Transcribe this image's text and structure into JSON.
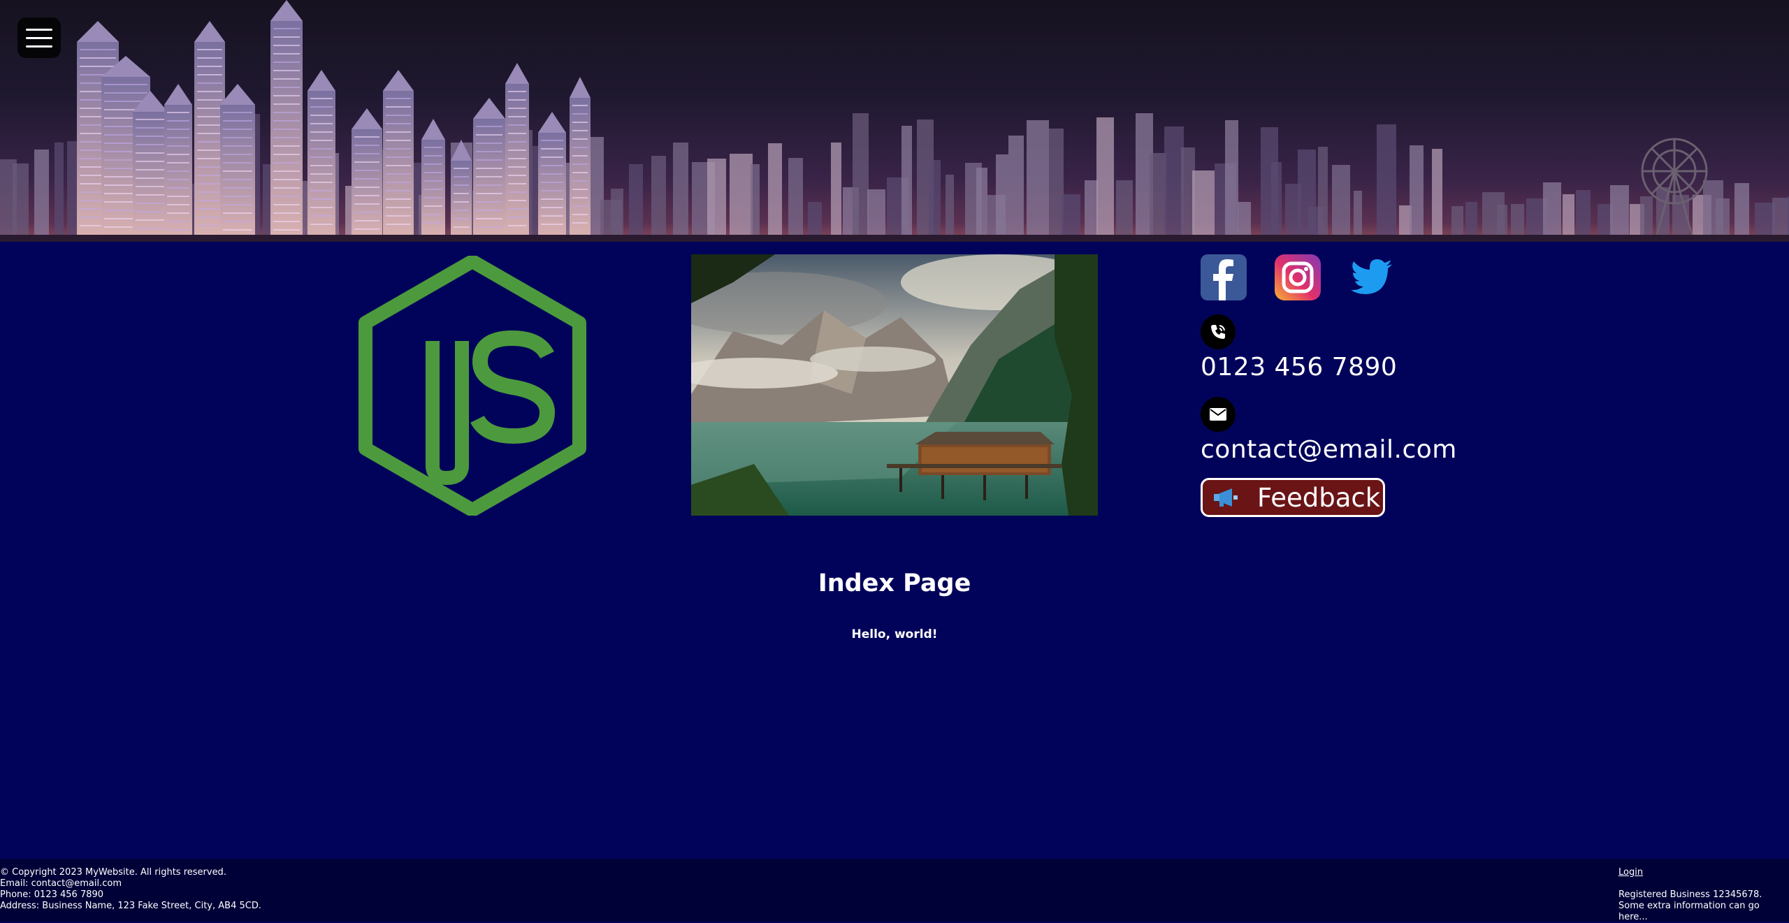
{
  "banner": {
    "menu_icon": "hamburger-menu-icon"
  },
  "logo": {
    "icon": "nodejs-logo",
    "text": "JS",
    "color": "#4c9a3d"
  },
  "hero_image": {
    "icon": "mountain-lake-photo"
  },
  "social": {
    "facebook_icon": "facebook-icon",
    "instagram_icon": "instagram-icon",
    "twitter_icon": "twitter-icon"
  },
  "contact": {
    "phone_icon": "phone-icon",
    "phone": "0123 456 7890",
    "email_icon": "mail-icon",
    "email": "contact@email.com"
  },
  "feedback": {
    "label": "Feedback",
    "icon": "megaphone-icon",
    "bg": "#6a1416"
  },
  "main": {
    "title": "Index Page",
    "text": "Hello, world!"
  },
  "footer": {
    "copyright": "© Copyright 2023 MyWebsite. All rights reserved.",
    "email": "Email: contact@email.com",
    "phone": "Phone: 0123 456 7890",
    "address": "Address: Business Name, 123 Fake Street, City, AB4 5CD.",
    "login": "Login",
    "registered": "Registered Business 12345678.",
    "extra": "Some extra information can go here..."
  },
  "colors": {
    "page_bg": "#01035a",
    "footer_bg": "#000237"
  }
}
